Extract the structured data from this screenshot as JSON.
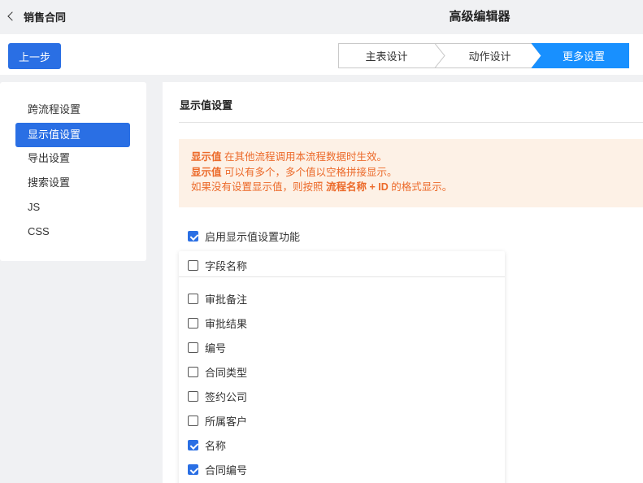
{
  "header": {
    "back_label": "销售合同",
    "title": "高级编辑器"
  },
  "toolbar": {
    "prev_button": "上一步",
    "steps": [
      {
        "label": "主表设计",
        "active": false
      },
      {
        "label": "动作设计",
        "active": false
      },
      {
        "label": "更多设置",
        "active": true
      }
    ]
  },
  "sidebar": {
    "items": [
      {
        "label": "跨流程设置",
        "active": false
      },
      {
        "label": "显示值设置",
        "active": true
      },
      {
        "label": "导出设置",
        "active": false
      },
      {
        "label": "搜索设置",
        "active": false
      },
      {
        "label": "JS",
        "active": false
      },
      {
        "label": "CSS",
        "active": false
      }
    ]
  },
  "main": {
    "title": "显示值设置",
    "notice": {
      "line1_bold": "显示值",
      "line1_text": " 在其他流程调用本流程数据时生效。",
      "line2_bold": "显示值",
      "line2_text": " 可以有多个，多个值以空格拼接显示。",
      "line3_text": "如果没有设置显示值，则按照 ",
      "line3_bold": "流程名称 + ID",
      "line3_tail": " 的格式显示。"
    },
    "enable": {
      "label": "启用显示值设置功能",
      "checked": true
    },
    "field_header": {
      "label": "字段名称",
      "checked": false
    },
    "fields": [
      {
        "label": "审批备注",
        "checked": false
      },
      {
        "label": "审批结果",
        "checked": false
      },
      {
        "label": "编号",
        "checked": false
      },
      {
        "label": "合同类型",
        "checked": false
      },
      {
        "label": "签约公司",
        "checked": false
      },
      {
        "label": "所属客户",
        "checked": false
      },
      {
        "label": "名称",
        "checked": true
      },
      {
        "label": "合同编号",
        "checked": true
      }
    ]
  },
  "colors": {
    "accent": "#2a6fe4",
    "step_active": "#1890ff",
    "notice_bg": "#fdf1e6",
    "notice_text": "#ec6a2a"
  }
}
